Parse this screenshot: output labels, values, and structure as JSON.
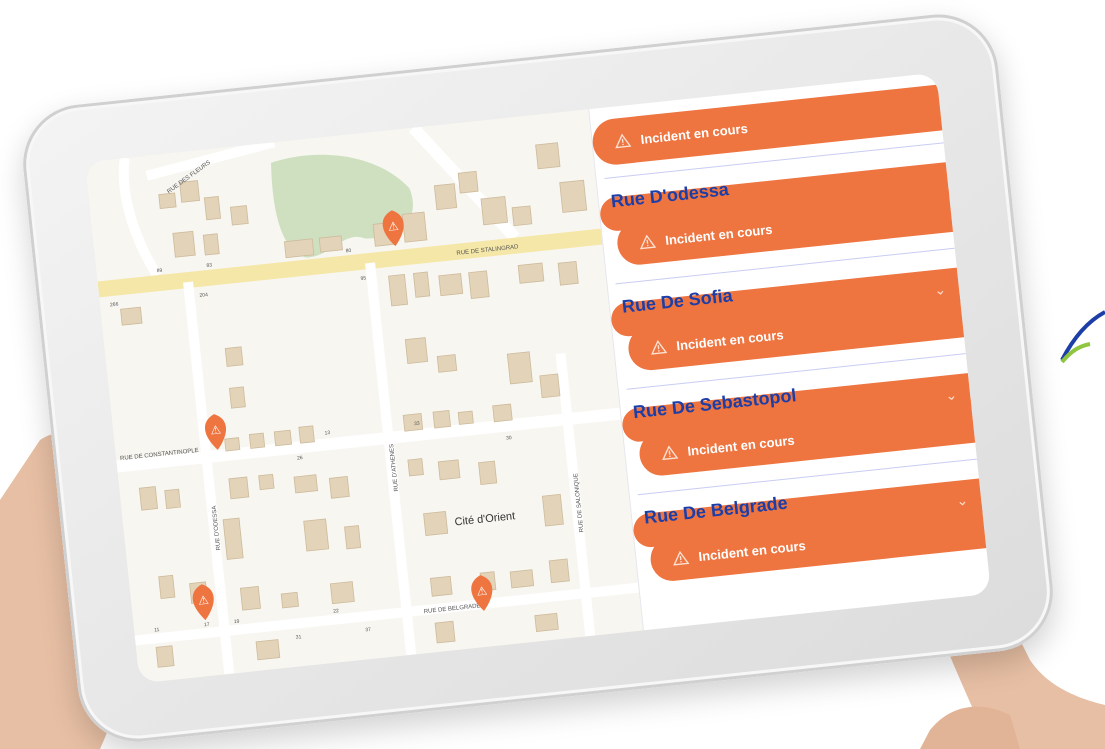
{
  "map": {
    "labels": {
      "rue_des_fleurs": "RUE DES FLEURS",
      "rue_de_stalingrad": "RUE DE STALINGRAD",
      "rue_de_constantinople": "RUE DE CONSTANTINOPLE",
      "rue_d_odessa": "RUE D'ODESSA",
      "rue_d_athenes": "RUE D'ATHENES",
      "rue_de_salonique": "RUE DE SALONIQUE",
      "rue_de_belgrade": "RUE DE BELGRADE",
      "cite_d_orient": "Cité d'Orient"
    },
    "house_numbers": [
      "89",
      "83",
      "80",
      "266",
      "204",
      "95",
      "26",
      "13",
      "17",
      "19",
      "30",
      "33",
      "11",
      "31",
      "37",
      "22"
    ],
    "marker_icon": "warning-marker-icon",
    "colors": {
      "road": "#f5e7a8",
      "building": "#e3d3b8",
      "park": "#cfe0c1",
      "street": "#ffffff"
    }
  },
  "panel": {
    "top_incident": "Incident en cours",
    "streets": [
      {
        "name": "Rue D'odessa",
        "incident": "Incident en cours"
      },
      {
        "name": "Rue De Sofia",
        "incident": "Incident en cours"
      },
      {
        "name": "Rue De Sebastopol",
        "incident": "Incident en cours"
      },
      {
        "name": "Rue De Belgrade",
        "incident": "Incident en cours"
      }
    ],
    "warning_icon": "warning-icon",
    "chevron_icon": "chevron-down-icon"
  },
  "colors": {
    "accent": "#ee7440",
    "street_title": "#1c3ea6",
    "divider": "#c8cdf2"
  }
}
